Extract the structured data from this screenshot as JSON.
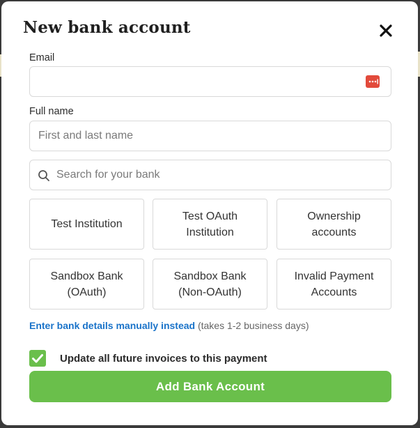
{
  "modal": {
    "title": "New bank account"
  },
  "email": {
    "label": "Email",
    "value": "",
    "placeholder": ""
  },
  "full_name": {
    "label": "Full name",
    "value": "",
    "placeholder": "First and last name"
  },
  "search": {
    "value": "",
    "placeholder": "Search for your bank"
  },
  "banks": [
    {
      "label": "Test Institution"
    },
    {
      "label": "Test OAuth\nInstitution"
    },
    {
      "label": "Ownership\naccounts"
    },
    {
      "label": "Sandbox Bank\n(OAuth)"
    },
    {
      "label": "Sandbox Bank\n(Non-OAuth)"
    },
    {
      "label": "Invalid Payment\nAccounts"
    }
  ],
  "manual_entry": {
    "link": "Enter bank details manually instead",
    "note": "(takes 1-2 business days)"
  },
  "update_invoices": {
    "label": "Update all future invoices to this payment",
    "checked": true
  },
  "submit_label": "Add Bank Account",
  "icons": {
    "close": "close-icon",
    "password_manager": "password-manager-icon",
    "search": "search-icon",
    "check": "check-icon"
  },
  "colors": {
    "accent": "#6abf4b",
    "link": "#1a73c9",
    "password_icon": "#e24a3b"
  }
}
